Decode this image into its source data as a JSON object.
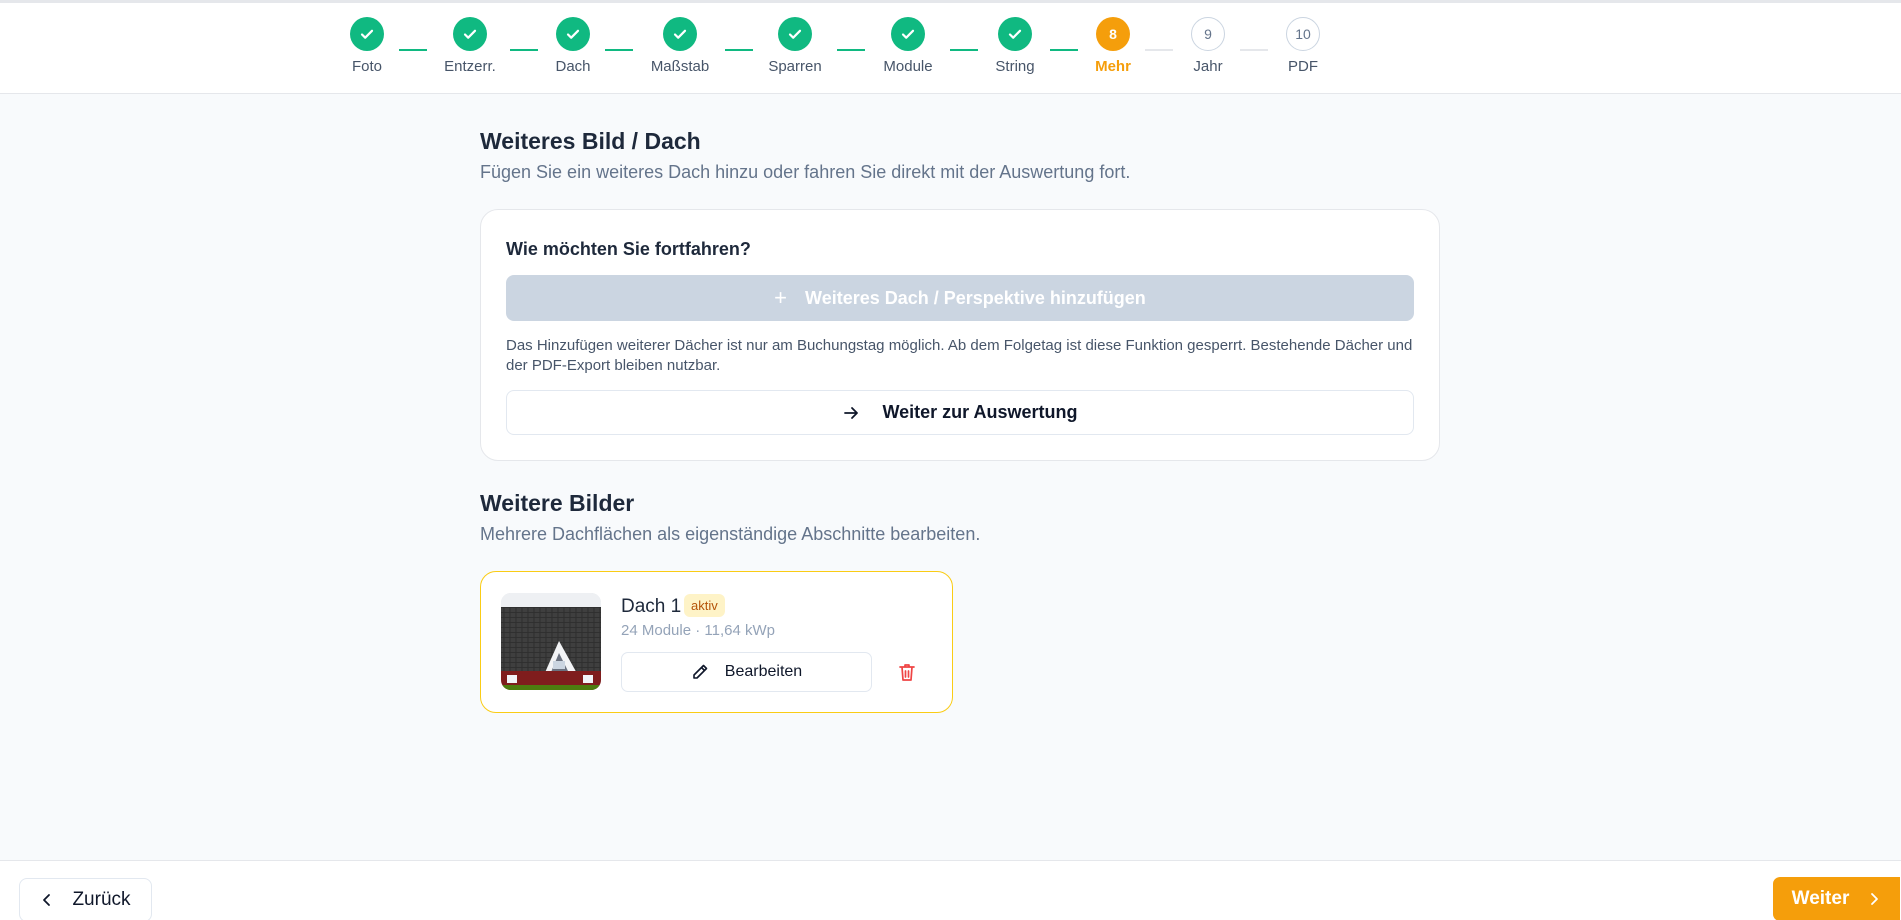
{
  "stepper": {
    "steps": [
      {
        "label": "Foto",
        "state": "done"
      },
      {
        "label": "Entzerr.",
        "state": "done"
      },
      {
        "label": "Dach",
        "state": "done"
      },
      {
        "label": "Maßstab",
        "state": "done"
      },
      {
        "label": "Sparren",
        "state": "done"
      },
      {
        "label": "Module",
        "state": "done"
      },
      {
        "label": "String",
        "state": "done"
      },
      {
        "label": "Mehr",
        "state": "current",
        "number": "8"
      },
      {
        "label": "Jahr",
        "state": "todo",
        "number": "9"
      },
      {
        "label": "PDF",
        "state": "todo",
        "number": "10"
      }
    ],
    "icon": "check-icon"
  },
  "more_image": {
    "title": "Weiteres Bild / Dach",
    "subtitle": "Fügen Sie ein weiteres Dach hinzu oder fahren Sie direkt mit der Auswertung fort.",
    "question": "Wie möchten Sie fortfahren?",
    "add_button": "Weiteres Dach / Perspektive hinzufügen",
    "add_icon": "+",
    "hint": "Das Hinzufügen weiterer Dächer ist nur am Buchungstag möglich. Ab dem Folgetag ist diese Funktion gesperrt. Bestehende Dächer und der PDF-Export bleiben nutzbar.",
    "continue_button": "Weiter zur Auswertung"
  },
  "more_images": {
    "title": "Weitere Bilder",
    "subtitle": "Mehrere Dachflächen als eigenständige Abschnitte bearbeiten.",
    "roofs": [
      {
        "name": "Dach 1",
        "badge": "aktiv",
        "meta": "24 Module · 11,64 kWp",
        "edit_label": "Bearbeiten"
      }
    ]
  },
  "footer": {
    "back_label": "Zurück",
    "next_label": "Weiter"
  },
  "colors": {
    "accent": "#f59e0b",
    "done": "#10b981",
    "danger": "#ef4444",
    "active_border": "#facc15"
  }
}
